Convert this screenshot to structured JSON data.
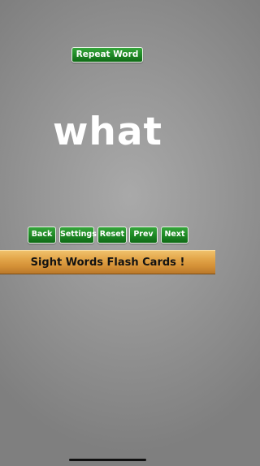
{
  "app": {
    "repeat_button_label": "Repeat Word",
    "current_word": "what",
    "controls": [
      {
        "id": "back",
        "label": "Back"
      },
      {
        "id": "settings",
        "label": "Settings"
      },
      {
        "id": "reset",
        "label": "Reset"
      },
      {
        "id": "prev",
        "label": "Prev"
      },
      {
        "id": "next",
        "label": "Next"
      }
    ],
    "banner_title": "Sight Words Flash Cards !"
  },
  "colors": {
    "button_green": "#1f8a26",
    "banner_wood": "#e3a64a",
    "background_gray": "#979797"
  }
}
